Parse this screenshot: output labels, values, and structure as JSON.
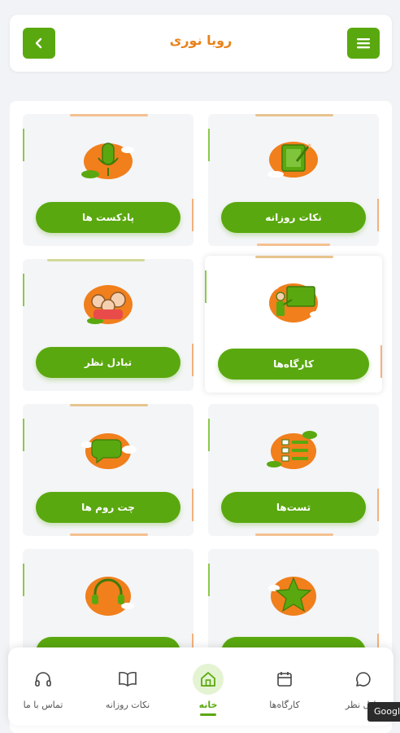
{
  "header": {
    "title": "رویا نوری"
  },
  "cards": [
    {
      "label": "پادکست ها"
    },
    {
      "label": "نکات روزانه"
    },
    {
      "label": "تبادل نظر"
    },
    {
      "label": "کارگاه‌ها"
    },
    {
      "label": "چت روم ها"
    },
    {
      "label": "تست‌ها"
    }
  ],
  "tabs": [
    {
      "label": "تماس با ما"
    },
    {
      "label": "نکات روزانه"
    },
    {
      "label": "خانه"
    },
    {
      "label": "کارگاه‌ها"
    },
    {
      "label": "تبادل نظر"
    }
  ],
  "tooltip": {
    "text": "Google"
  },
  "colors": {
    "primary": "#5aa80f",
    "accent": "#e8821a",
    "orange": "#f07f1c"
  }
}
